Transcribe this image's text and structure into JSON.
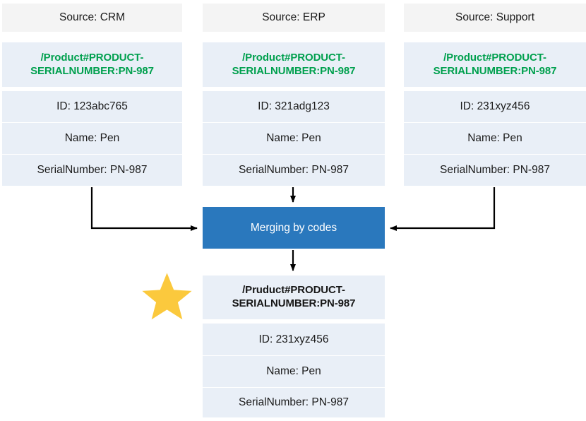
{
  "colors": {
    "header_bg": "#f4f4f4",
    "row_bg": "#e9eff7",
    "code_green": "#00a04e",
    "merge_blue": "#2a78bd",
    "star_yellow": "#fbc93d",
    "arrow_black": "#000000",
    "text_dark": "#1a1a1a"
  },
  "sources": [
    {
      "header": "Source: CRM",
      "code": "/Product#PRODUCT-SERIALNUMBER:PN-987",
      "id": "ID: 123abc765",
      "name": "Name: Pen",
      "serial": "SerialNumber: PN-987"
    },
    {
      "header": "Source: ERP",
      "code": "/Product#PRODUCT-SERIALNUMBER:PN-987",
      "id": "ID: 321adg123",
      "name": "Name: Pen",
      "serial": "SerialNumber: PN-987"
    },
    {
      "header": "Source: Support",
      "code": "/Product#PRODUCT-SERIALNUMBER:PN-987",
      "id": "ID: 231xyz456",
      "name": "Name: Pen",
      "serial": "SerialNumber: PN-987"
    }
  ],
  "merge": {
    "label": "Merging by codes"
  },
  "result": {
    "code": "/Pruduct#PRODUCT-SERIALNUMBER:PN-987",
    "id": "ID: 231xyz456",
    "name": "Name: Pen",
    "serial": "SerialNumber: PN-987"
  },
  "star": {
    "icon": "star-icon"
  }
}
